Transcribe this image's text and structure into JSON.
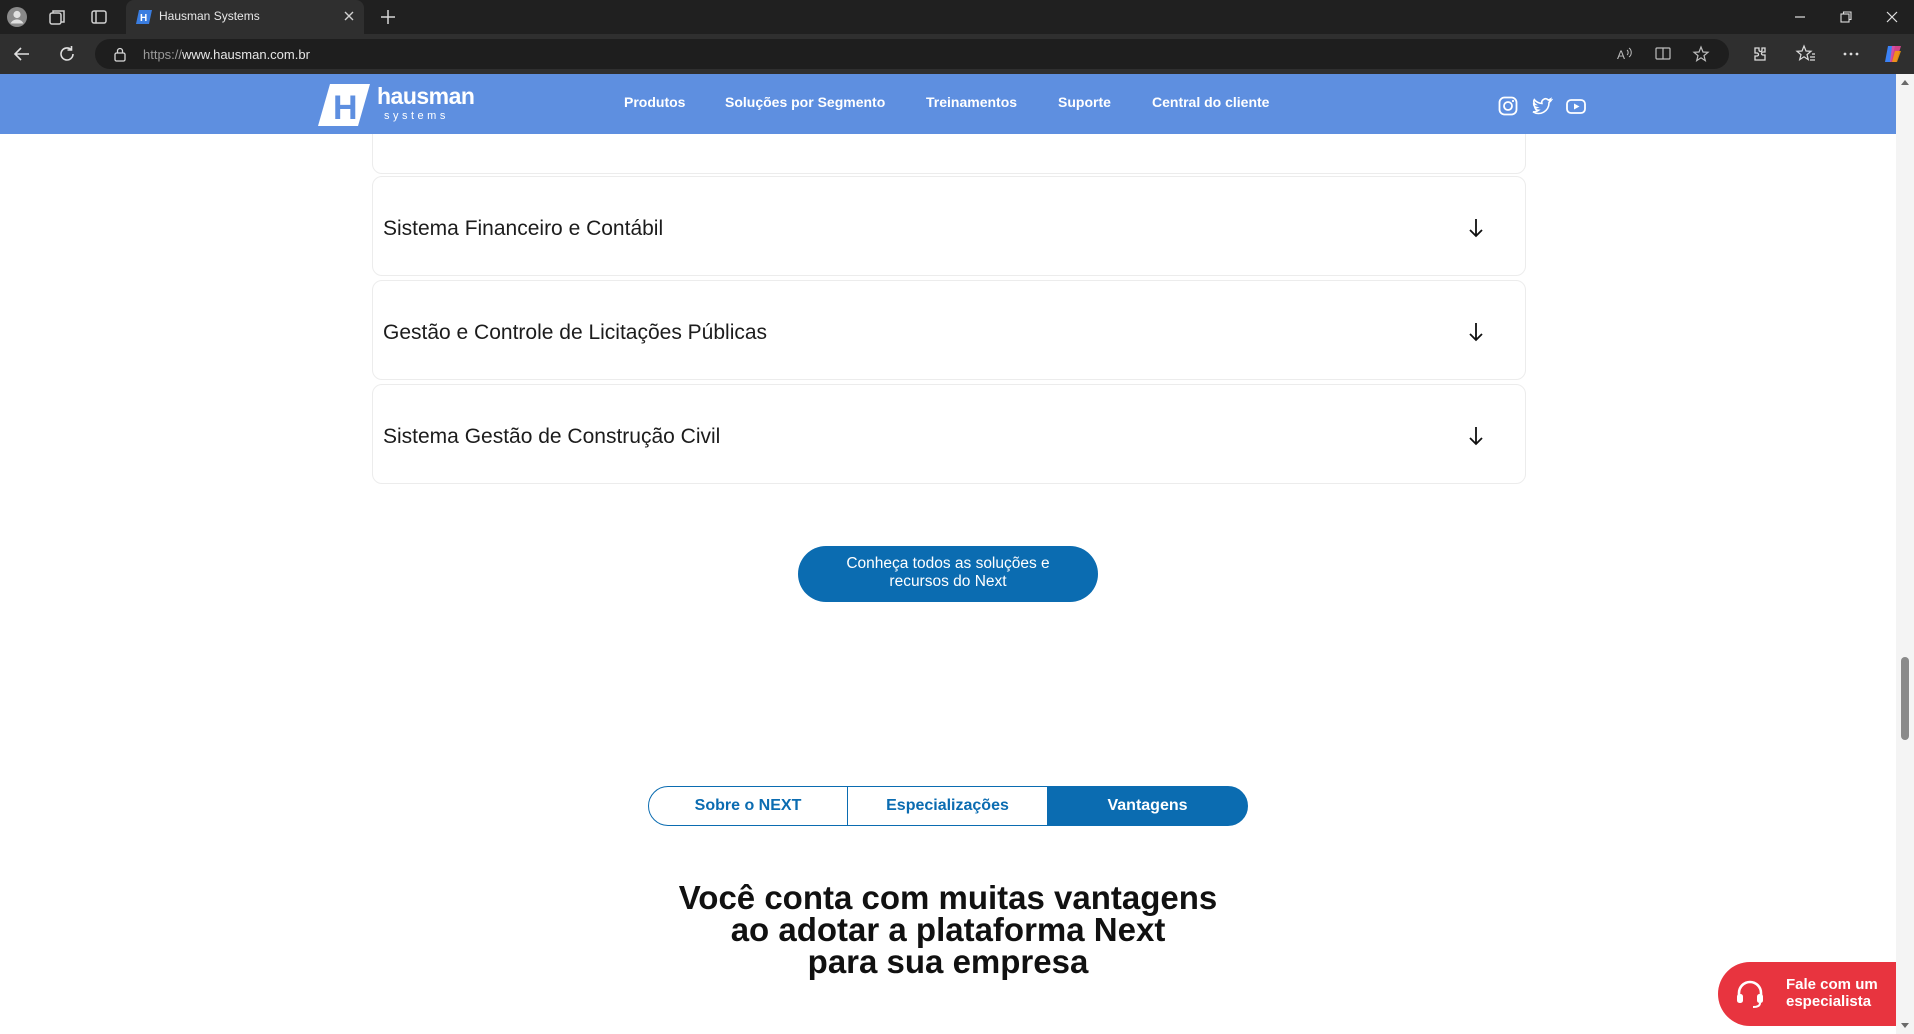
{
  "browser": {
    "tab_title": "Hausman Systems",
    "url_protocol": "https://",
    "url_host": "www.hausman.com.br"
  },
  "header": {
    "logo_word": "hausman",
    "logo_sub": "systems",
    "logo_letter": "H",
    "menu": [
      "Produtos",
      "Soluções por Segmento",
      "Treinamentos",
      "Suporte",
      "Central do cliente"
    ],
    "social": [
      "instagram-icon",
      "twitter-icon",
      "youtube-icon"
    ],
    "bg_color": "#5e8fe0"
  },
  "accordion": [
    {
      "title": "Sistema Financeiro e Contábil"
    },
    {
      "title": "Gestão e Controle de Licitações Públicas"
    },
    {
      "title": "Sistema Gestão de Construção Civil"
    }
  ],
  "cta": {
    "line1": "Conheça todos as soluções e",
    "line2": "recursos do Next"
  },
  "tabs": {
    "items": [
      "Sobre o NEXT",
      "Especializações",
      "Vantagens"
    ],
    "active": "Vantagens"
  },
  "headline": {
    "line1": "Você conta com muitas vantagens",
    "line2": "ao adotar a plataforma Next",
    "line3": "para sua empresa"
  },
  "help": {
    "line1": "Fale com um",
    "line2": "especialista"
  },
  "colors": {
    "primary": "#0b6cb1",
    "help": "#e8343f"
  }
}
